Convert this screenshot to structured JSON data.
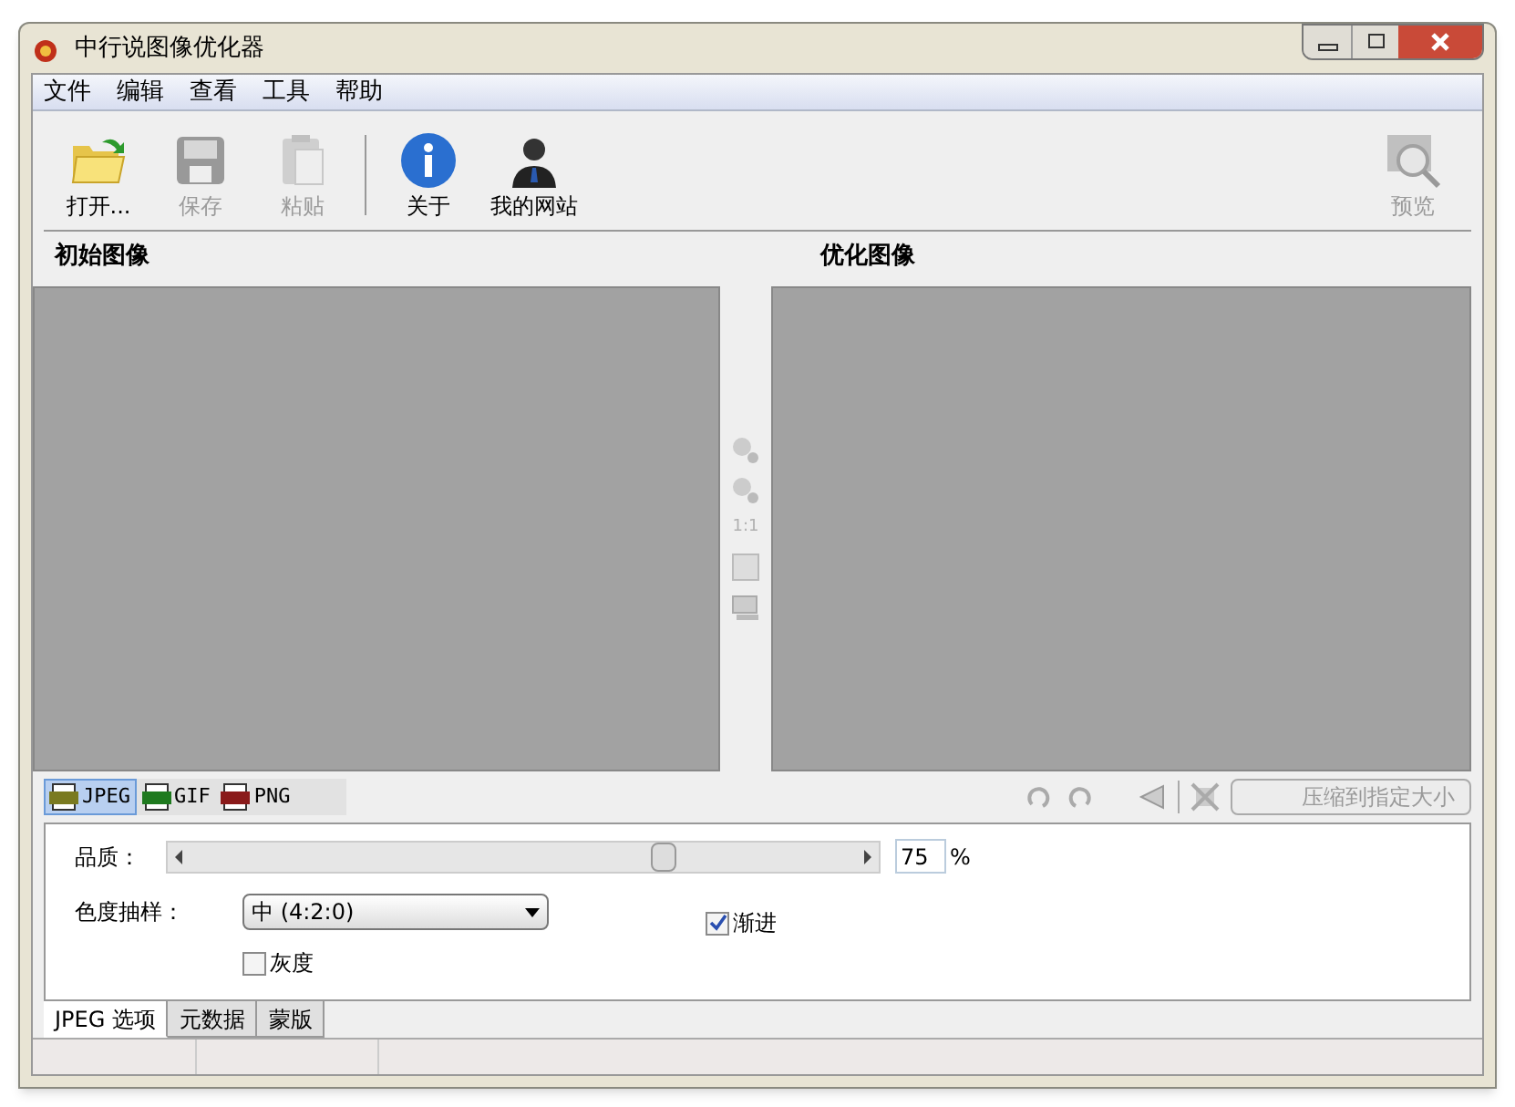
{
  "window": {
    "title": "中行说图像优化器"
  },
  "menu": [
    "文件",
    "编辑",
    "查看",
    "工具",
    "帮助"
  ],
  "toolbar": {
    "file_buttons": [
      {
        "kind": "open",
        "label": "打开...",
        "disabled": false
      },
      {
        "kind": "save",
        "label": "保存",
        "disabled": true
      },
      {
        "kind": "paste",
        "label": "粘贴",
        "disabled": true
      }
    ],
    "info_buttons": [
      {
        "kind": "about",
        "label": "关于",
        "disabled": false
      },
      {
        "kind": "website",
        "label": "我的网站",
        "disabled": false
      }
    ],
    "preview_button": {
      "label": "预览",
      "disabled": true
    }
  },
  "panes": [
    {
      "title": "初始图像"
    },
    {
      "title": "优化图像"
    }
  ],
  "zoom_tools": {
    "actual_size_label": "1:1"
  },
  "format_tabs": [
    {
      "kind": "jpg",
      "label": "JPEG",
      "selected": true
    },
    {
      "kind": "gif",
      "label": "GIF",
      "selected": false
    },
    {
      "kind": "png",
      "label": "PNG",
      "selected": false
    }
  ],
  "compress_button": {
    "label": "压缩到指定大小",
    "disabled": true
  },
  "options": {
    "quality": {
      "label": "品质：",
      "level": 0.72,
      "value": "75",
      "unit": "%"
    },
    "chroma": {
      "label": "色度抽样：",
      "value": "中 (4:2:0)"
    },
    "progressive": {
      "label": "渐进",
      "checked": true
    },
    "grayscale": {
      "label": "灰度",
      "checked": false
    }
  },
  "option_tabs": [
    {
      "label": "JPEG 选项",
      "selected": true
    },
    {
      "label": "元数据",
      "selected": false
    },
    {
      "label": "蒙版",
      "selected": false
    }
  ]
}
